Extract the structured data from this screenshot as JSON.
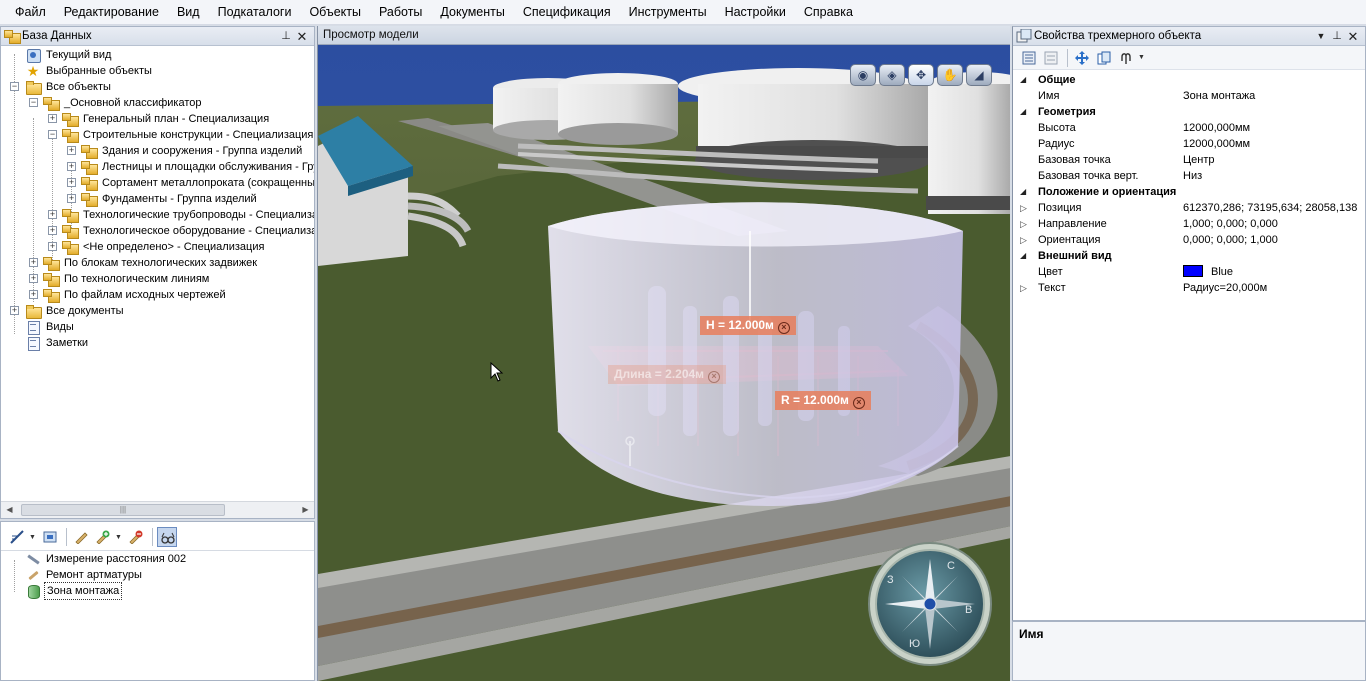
{
  "menu": [
    "Файл",
    "Редактирование",
    "Вид",
    "Подкаталоги",
    "Объекты",
    "Работы",
    "Документы",
    "Спецификация",
    "Инструменты",
    "Настройки",
    "Справка"
  ],
  "database_panel": {
    "title": "База Данных",
    "pin_label": "⊥",
    "close_label": "✕",
    "tree": [
      {
        "label": "Текущий вид",
        "icon": "view-icon"
      },
      {
        "label": "Выбранные объекты",
        "icon": "star-icon"
      },
      {
        "label": "Все объекты",
        "icon": "folder-icon"
      },
      {
        "label": "_Основной классификатор",
        "icon": "classifier-icon"
      },
      {
        "label": "Генеральный план - Специализация",
        "icon": "classifier-icon"
      },
      {
        "label": "Строительные конструкции - Специализация",
        "icon": "classifier-icon"
      },
      {
        "label": "Здания и сооружения - Группа изделий",
        "icon": "classifier-icon"
      },
      {
        "label": "Лестницы и площадки обслуживания - Группа изделий",
        "icon": "classifier-icon"
      },
      {
        "label": "Сортамент металлопроката (сокращенный)",
        "icon": "classifier-icon"
      },
      {
        "label": "Фундаменты - Группа изделий",
        "icon": "classifier-icon"
      },
      {
        "label": "Технологические трубопроводы - Специализация",
        "icon": "classifier-icon"
      },
      {
        "label": "Технологическое оборудование - Специализация",
        "icon": "classifier-icon"
      },
      {
        "label": "<Не определено> - Специализация",
        "icon": "classifier-icon"
      },
      {
        "label": "По блокам технологических задвижек",
        "icon": "classifier-icon"
      },
      {
        "label": "По технологическим линиям",
        "icon": "classifier-icon"
      },
      {
        "label": "По файлам исходных чертежей",
        "icon": "classifier-icon"
      },
      {
        "label": "Все документы",
        "icon": "folder-icon"
      },
      {
        "label": "Виды",
        "icon": "doc-icon"
      },
      {
        "label": "Заметки",
        "icon": "doc-icon"
      }
    ]
  },
  "notes_panel": {
    "items": [
      {
        "label": "Измерение расстояния 002",
        "icon": "ruler-icon"
      },
      {
        "label": "Ремонт артматуры",
        "icon": "wrench-icon"
      },
      {
        "label": "Зона монтажа",
        "icon": "cylinder-icon",
        "selected": true
      }
    ]
  },
  "viewport": {
    "title": "Просмотр модели",
    "nav_buttons": [
      "eye-icon",
      "cube-icon",
      "orbit-icon",
      "pan-hand-icon",
      "zoom-icon"
    ],
    "dimension_labels": {
      "height": "H = 12.000м",
      "length": "Длина = 2.204м",
      "radius": "R = 12.000м"
    },
    "compass": {
      "letters": [
        "С",
        "В",
        "Ю",
        "З"
      ]
    }
  },
  "properties_panel": {
    "title": "Свойства трехмерного объекта",
    "dropdown_label": "▼",
    "pin_label": "⊥",
    "close_label": "✕",
    "toolbar_icons": [
      "sort-category-icon",
      "sort-alpha-icon",
      "move-icon",
      "copy-icon",
      "branch-icon"
    ],
    "rows": [
      {
        "type": "cat",
        "name": "Общие"
      },
      {
        "type": "prop",
        "name": "Имя",
        "value": "Зона монтажа"
      },
      {
        "type": "cat",
        "name": "Геометрия"
      },
      {
        "type": "prop",
        "name": "Высота",
        "value": "12000,000мм"
      },
      {
        "type": "prop",
        "name": "Радиус",
        "value": "12000,000мм"
      },
      {
        "type": "prop",
        "name": "Базовая точка",
        "value": "Центр"
      },
      {
        "type": "prop",
        "name": "Базовая точка верт.",
        "value": "Низ"
      },
      {
        "type": "cat",
        "name": "Положение и ориентация"
      },
      {
        "type": "prop",
        "name": "Позиция",
        "value": "612370,286; 73195,634; 28058,138",
        "expandable": true
      },
      {
        "type": "prop",
        "name": "Направление",
        "value": "1,000; 0,000; 0,000",
        "expandable": true
      },
      {
        "type": "prop",
        "name": "Ориентация",
        "value": "0,000; 0,000; 1,000",
        "expandable": true
      },
      {
        "type": "cat",
        "name": "Внешний вид"
      },
      {
        "type": "prop",
        "name": "Цвет",
        "value": "Blue",
        "color": "#0000ff"
      },
      {
        "type": "prop",
        "name": "Текст",
        "value": "Радиус=20,000м",
        "expandable": true
      }
    ],
    "description_title": "Имя"
  }
}
